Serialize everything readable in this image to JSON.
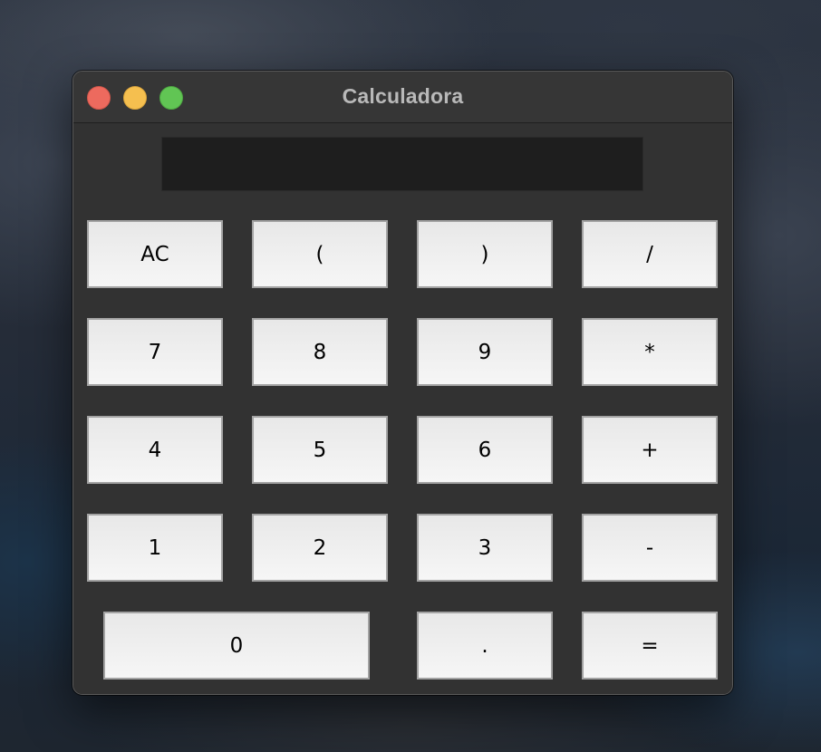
{
  "window": {
    "title": "Calculadora"
  },
  "display": {
    "value": ""
  },
  "keys": {
    "clear": "AC",
    "paren_open": "(",
    "paren_close": ")",
    "divide": "/",
    "seven": "7",
    "eight": "8",
    "nine": "9",
    "multiply": "*",
    "four": "4",
    "five": "5",
    "six": "6",
    "plus": "+",
    "one": "1",
    "two": "2",
    "three": "3",
    "minus": "-",
    "zero": "0",
    "decimal": ".",
    "equals": "="
  },
  "colors": {
    "close": "#ed6a5e",
    "minimize": "#f5bf4f",
    "zoom": "#61c554",
    "window_bg": "#323232",
    "display_bg": "#1e1e1e",
    "key_bg": "#f0f0f0"
  }
}
